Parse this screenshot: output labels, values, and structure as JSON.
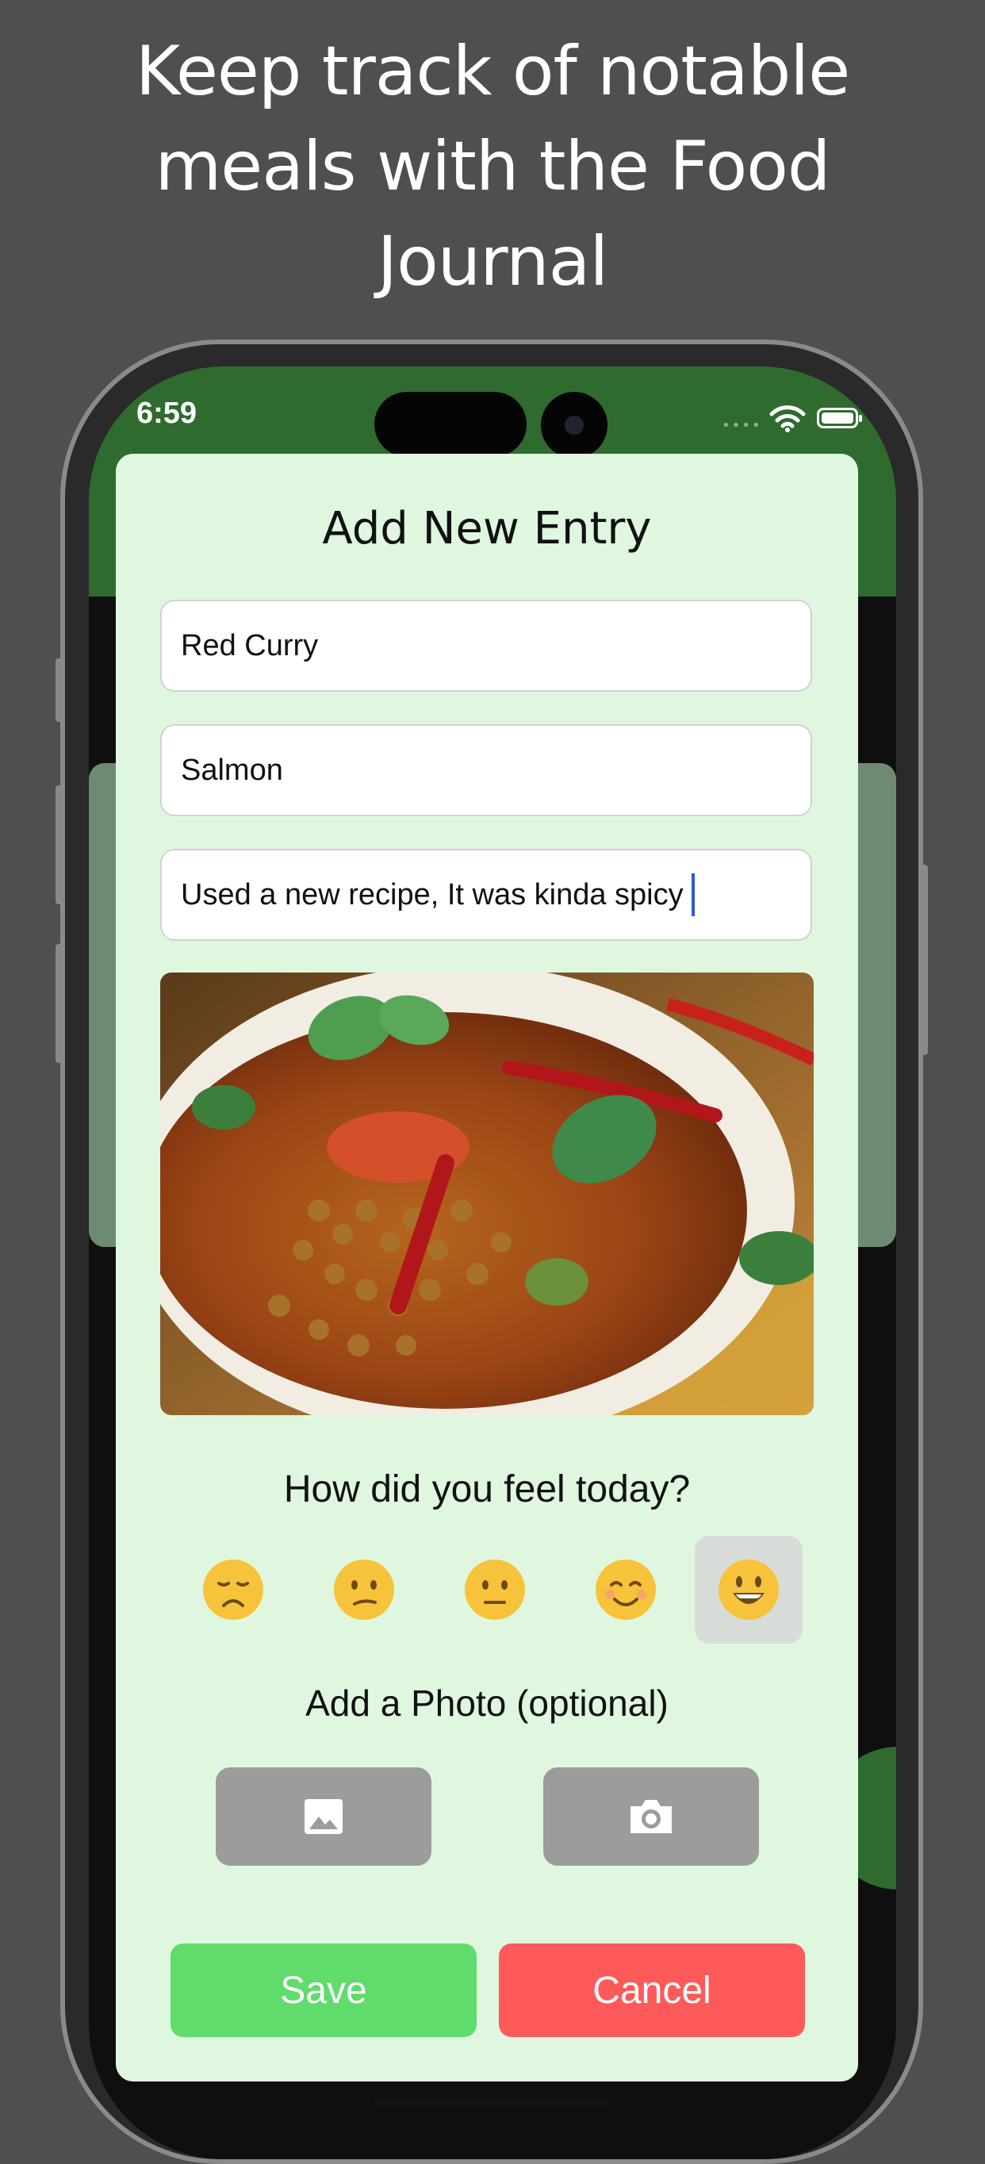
{
  "promo": {
    "headline_lines": [
      "Keep track of notable",
      "meals with the Food",
      "Journal"
    ]
  },
  "status_bar": {
    "time": "6:59",
    "icons": [
      "cellular-dots-icon",
      "wifi-icon",
      "battery-icon"
    ]
  },
  "sheet": {
    "title": "Add New Entry",
    "fields": {
      "meal_name": "Red Curry",
      "ingredient": "Salmon",
      "notes": "Used a new recipe, It was kinda spicy"
    },
    "photo": {
      "alt": "red curry photo"
    },
    "mood": {
      "prompt": "How did you feel today?",
      "options": [
        "very-sad-face-icon",
        "confused-face-icon",
        "neutral-face-icon",
        "smiling-face-icon",
        "grinning-face-icon"
      ],
      "selected_index": 4
    },
    "photo_section": {
      "label": "Add a Photo (optional)",
      "buttons": [
        "photo-library-icon",
        "camera-icon"
      ]
    },
    "actions": {
      "save_label": "Save",
      "cancel_label": "Cancel"
    }
  },
  "colors": {
    "background": "#4f4f4f",
    "header_green": "#2f6b2e",
    "sheet_bg": "#dff7df",
    "save": "#5fdc6b",
    "cancel": "#ff5a5a",
    "photo_button": "#9c9c9c",
    "caret": "#2f5bd6"
  }
}
